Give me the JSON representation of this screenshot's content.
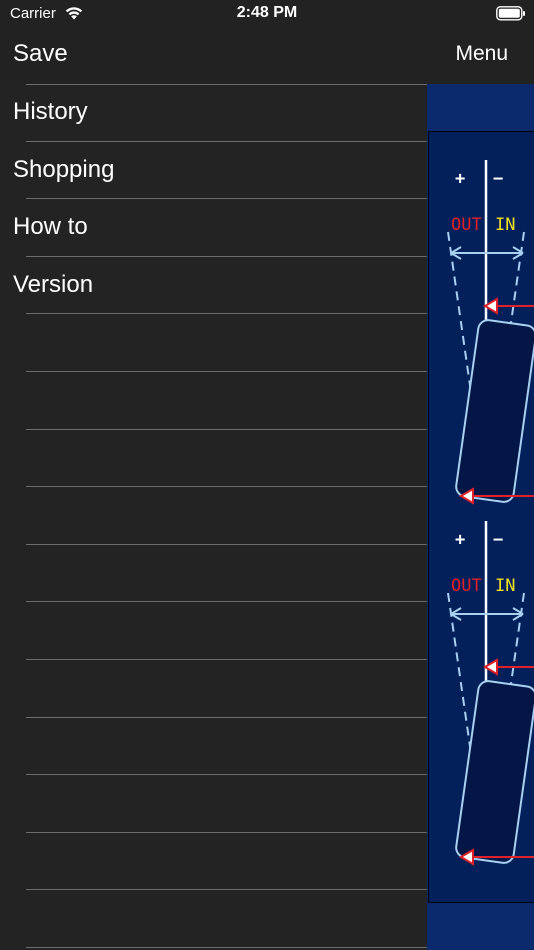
{
  "status_bar": {
    "carrier": "Carrier",
    "time": "2:48 PM"
  },
  "toolbar": {
    "save_label": "Save",
    "menu_label": "Menu"
  },
  "drawer": {
    "items": [
      {
        "label": "History"
      },
      {
        "label": "Shopping"
      },
      {
        "label": "How to"
      },
      {
        "label": "Version"
      },
      {
        "label": ""
      },
      {
        "label": ""
      },
      {
        "label": ""
      },
      {
        "label": ""
      },
      {
        "label": ""
      },
      {
        "label": ""
      },
      {
        "label": ""
      },
      {
        "label": ""
      },
      {
        "label": ""
      },
      {
        "label": ""
      },
      {
        "label": ""
      }
    ]
  },
  "diagram": {
    "plus_symbol": "+",
    "minus_symbol": "−",
    "out_label": "OUT",
    "in_label": "IN",
    "out_color": "#e0202a",
    "in_color": "#f0e020",
    "line_color": "#a8d0f0",
    "arrow_color": "#e0202a"
  },
  "colors": {
    "bar_bg": "#222222",
    "drawer_bg": "#232323",
    "content_bg": "#0b2a6e",
    "panel_bg": "#04205a"
  }
}
